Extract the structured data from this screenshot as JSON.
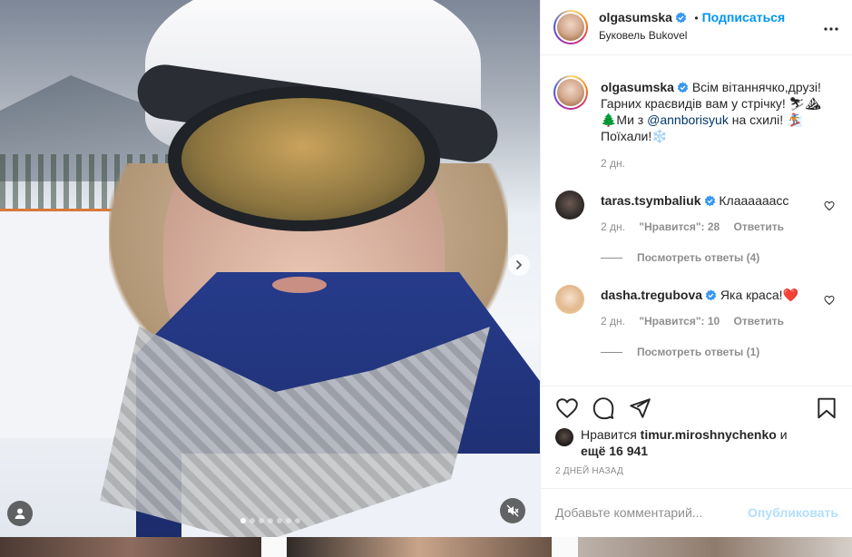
{
  "post": {
    "author": "olgasumska",
    "follow_label": "Подписаться",
    "separator": "•",
    "location": "Буковель Bukovel",
    "caption": {
      "line1": "Всім вітаннячко,друзі!",
      "line2": "Гарних краєвидів вам у стрічку!",
      "emoji1": "⛷⛰",
      "prefix_tree": "🌲Ми з",
      "mention": "@annborisyuk",
      "after_mention": "на схилі!",
      "emoji2": "🏂",
      "line4": "Поїхали!",
      "snowflake": "❄️",
      "time": "2 дн."
    },
    "carousel": {
      "slides": 7,
      "active_index": 0
    }
  },
  "comments": [
    {
      "user": "taras.tsymbaliuk",
      "text": "Клаааааасс",
      "time": "2 дн.",
      "likes_label": "\"Нравится\": 28",
      "reply_label": "Ответить",
      "view_replies": "Посмотреть ответы (4)"
    },
    {
      "user": "dasha.tregubova",
      "text": "Яка краса!❤️",
      "time": "2 дн.",
      "likes_label": "\"Нравится\": 10",
      "reply_label": "Ответить",
      "view_replies": "Посмотреть ответы (1)"
    }
  ],
  "likes": {
    "prefix": "Нравится",
    "user": "timur.miroshnychenko",
    "middle": "и",
    "rest": "ещё 16 941"
  },
  "time_ago": "2 ДНЕЙ НАЗАД",
  "add_comment": {
    "placeholder": "Добавьте комментарий...",
    "publish_label": "Опубликовать"
  },
  "icons": {
    "like": "heart-icon",
    "comment": "comment-icon",
    "share": "share-icon",
    "save": "bookmark-icon",
    "more": "more-icon",
    "verified": "verified-badge-icon",
    "next": "chevron-right-icon",
    "tags": "user-tag-icon",
    "mute": "sound-off-icon"
  },
  "colors": {
    "accent": "#0095f6",
    "verified": "#3897f0",
    "heart_red": "#ed4956",
    "muted_text": "#8e8e8e"
  }
}
